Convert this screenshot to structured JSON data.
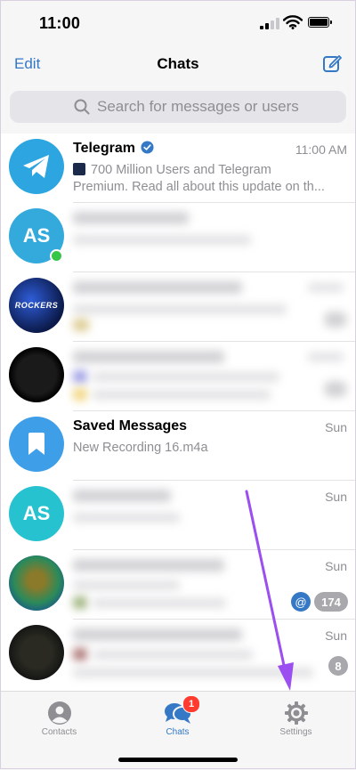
{
  "status_bar": {
    "time": "11:00"
  },
  "nav": {
    "edit_label": "Edit",
    "title": "Chats"
  },
  "search": {
    "placeholder": "Search for messages or users"
  },
  "chats": [
    {
      "name": "Telegram",
      "verified": true,
      "time": "11:00 AM",
      "line1": "700 Million Users and Telegram",
      "line2": "Premium. Read all about this update on th...",
      "avatar_icon": "paper-plane-icon",
      "avatar_color": "#2ca5e0"
    },
    {
      "name": "",
      "initials": "AS",
      "blurred": true,
      "avatar_color": "#34aadc",
      "online": true
    },
    {
      "name": "",
      "blurred": true,
      "avatar_kind": "image"
    },
    {
      "name": "",
      "blurred": true,
      "avatar_kind": "image"
    },
    {
      "name": "Saved Messages",
      "time": "Sun",
      "line1": "New Recording 16.m4a",
      "avatar_icon": "bookmark-icon",
      "avatar_color": "#3e9ee8"
    },
    {
      "name": "",
      "initials": "AS",
      "blurred": true,
      "time": "Sun",
      "avatar_color": "#27c2cf"
    },
    {
      "name": "",
      "blurred": true,
      "time": "Sun",
      "avatar_kind": "image",
      "mention_badge": "@",
      "unread_count": "174"
    },
    {
      "name": "",
      "blurred": true,
      "time": "Sun",
      "avatar_kind": "image",
      "unread_count": "8"
    }
  ],
  "tabs": [
    {
      "label": "Contacts",
      "icon": "person-icon"
    },
    {
      "label": "Chats",
      "icon": "chat-bubble-icon",
      "badge": "1",
      "active": true
    },
    {
      "label": "Settings",
      "icon": "gear-icon"
    }
  ],
  "colors": {
    "accent": "#3478c6",
    "arrow": "#9b4ff0",
    "badge_red": "#ff3b30"
  }
}
